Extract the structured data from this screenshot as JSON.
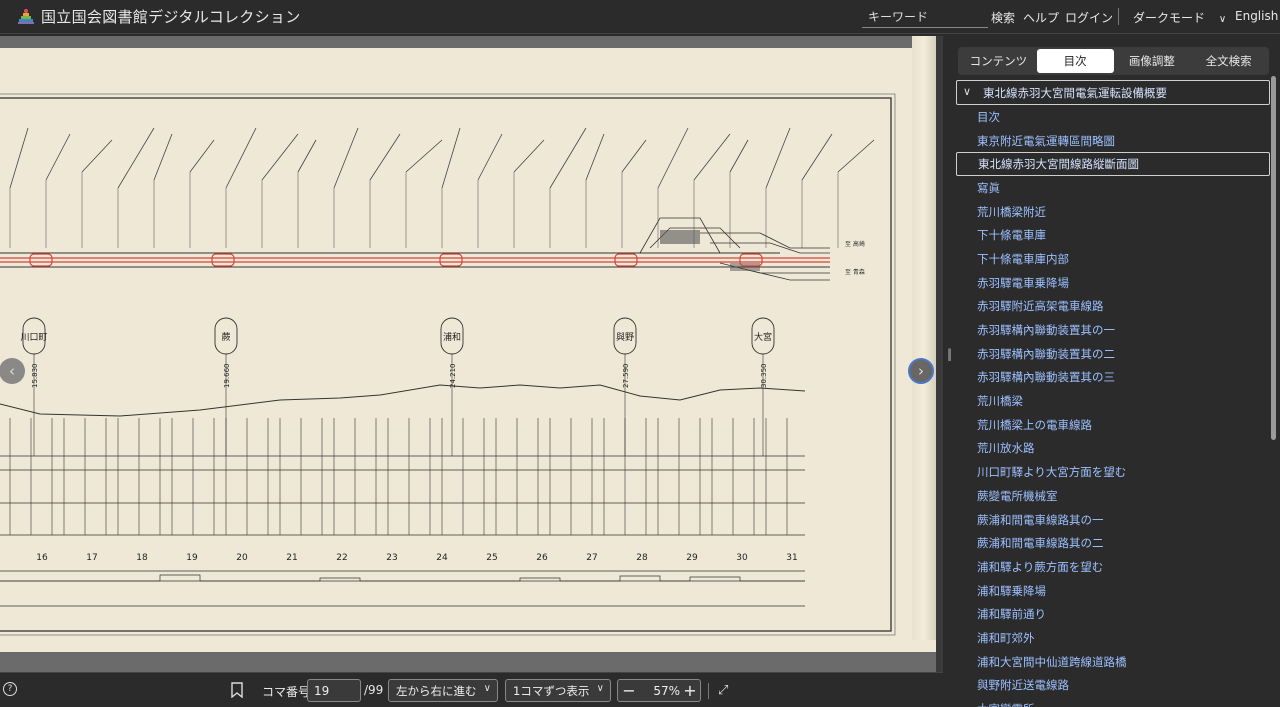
{
  "header": {
    "site_title": "国立国会図書館デジタルコレクション",
    "keyword_placeholder": "キーワード",
    "search_label": "検索",
    "help_label": "ヘルプ",
    "login_label": "ログイン",
    "dark_mode_label": "ダークモード",
    "language_label": "English"
  },
  "sidebar": {
    "tabs": [
      {
        "label": "コンテンツ",
        "active": false
      },
      {
        "label": "目次",
        "active": true
      },
      {
        "label": "画像調整",
        "active": false
      },
      {
        "label": "全文検索",
        "active": false
      }
    ],
    "toc_root": "東北線赤羽大宮間電氣運転設備概要",
    "toc_items": [
      {
        "label": "目次",
        "selected": false
      },
      {
        "label": "東京附近電氣運轉區間略圖",
        "selected": false
      },
      {
        "label": "東北線赤羽大宮間線路縦斷面圖",
        "selected": true
      },
      {
        "label": "寫眞",
        "selected": false
      },
      {
        "label": "荒川橋梁附近",
        "selected": false
      },
      {
        "label": "下十條電車庫",
        "selected": false
      },
      {
        "label": "下十條電車庫内部",
        "selected": false
      },
      {
        "label": "赤羽驛電車乗降場",
        "selected": false
      },
      {
        "label": "赤羽驛附近高架電車線路",
        "selected": false
      },
      {
        "label": "赤羽驛構內聯動装置其の一",
        "selected": false
      },
      {
        "label": "赤羽驛構內聯動装置其の二",
        "selected": false
      },
      {
        "label": "赤羽驛構內聯動装置其の三",
        "selected": false
      },
      {
        "label": "荒川橋梁",
        "selected": false
      },
      {
        "label": "荒川橋梁上の電車線路",
        "selected": false
      },
      {
        "label": "荒川放水路",
        "selected": false
      },
      {
        "label": "川口町驛より大宮方面を望む",
        "selected": false
      },
      {
        "label": "蕨變電所機械室",
        "selected": false
      },
      {
        "label": "蕨浦和間電車線路其の一",
        "selected": false
      },
      {
        "label": "蕨浦和間電車線路其の二",
        "selected": false
      },
      {
        "label": "浦和驛より蕨方面を望む",
        "selected": false
      },
      {
        "label": "浦和驛乗降場",
        "selected": false
      },
      {
        "label": "浦和驛前通り",
        "selected": false
      },
      {
        "label": "浦和町郊外",
        "selected": false
      },
      {
        "label": "浦和大宮間中仙道跨線道路橋",
        "selected": false
      },
      {
        "label": "與野附近送電線路",
        "selected": false
      },
      {
        "label": "大宮變電所",
        "selected": false
      }
    ]
  },
  "footer": {
    "page_label": "コマ番号",
    "page_value": "19",
    "page_total": "/99",
    "direction_label": "左から右に進む",
    "display_label": "1コマずつ表示",
    "zoom_value": "57",
    "zoom_unit": "%"
  },
  "viewer": {
    "station_labels": [
      {
        "name": "川口町",
        "km": "15.830"
      },
      {
        "name": "蕨",
        "km": "19.660"
      },
      {
        "name": "浦和",
        "km": "24.210"
      },
      {
        "name": "與野",
        "km": "27.590"
      },
      {
        "name": "大宮",
        "km": "30.350"
      }
    ],
    "km_markers": [
      "16",
      "17",
      "18",
      "19",
      "20",
      "21",
      "22",
      "23",
      "24",
      "25",
      "26",
      "27",
      "28",
      "29",
      "30",
      "31"
    ],
    "end_labels": [
      "至 高崎",
      "至 青森"
    ],
    "colors": {
      "track_red": "#d8433a",
      "paper": "#efe8d6",
      "ink": "#333333"
    }
  }
}
